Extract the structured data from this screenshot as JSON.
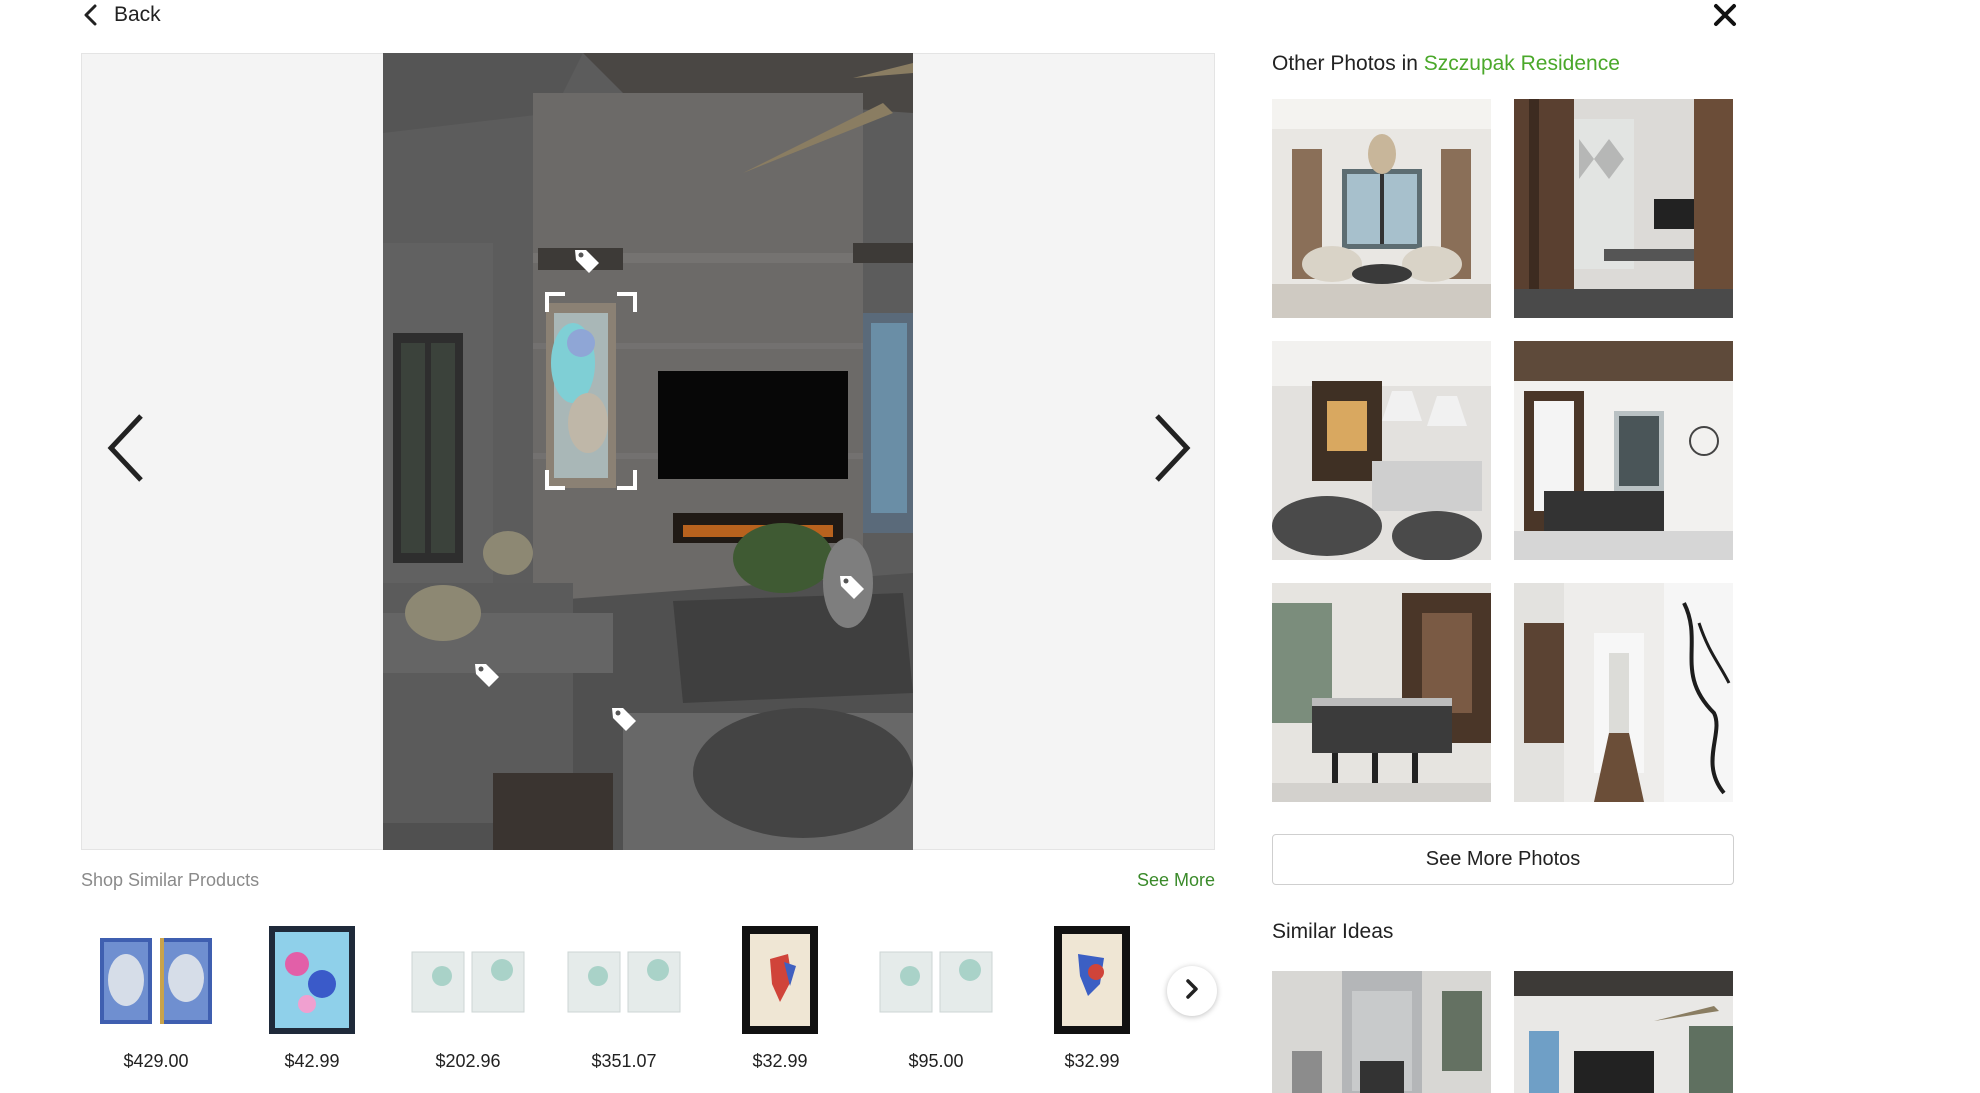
{
  "header": {
    "back_label": "Back",
    "back_icon": "chevron-left-icon",
    "close_icon": "close-icon"
  },
  "viewer": {
    "prev_icon": "chevron-left-icon",
    "next_icon": "chevron-right-icon",
    "tag_icon": "price-tag-icon",
    "tag_count": 5
  },
  "shop": {
    "title": "Shop Similar Products",
    "see_more": "See More",
    "products": [
      {
        "price": "$429.00"
      },
      {
        "price": "$42.99"
      },
      {
        "price": "$202.96"
      },
      {
        "price": "$351.07"
      },
      {
        "price": "$32.99"
      },
      {
        "price": "$95.00"
      },
      {
        "price": "$32.99"
      }
    ],
    "next_icon": "chevron-right-icon"
  },
  "sidebar": {
    "title_prefix": "Other Photos in",
    "project_name": "Szczupak Residence",
    "see_more_photos": "See More Photos",
    "similar_ideas": "Similar Ideas"
  },
  "colors": {
    "accent_green": "#4aa82a",
    "see_more_green": "#3a8a2a",
    "viewer_bg": "#f4f4f4"
  }
}
